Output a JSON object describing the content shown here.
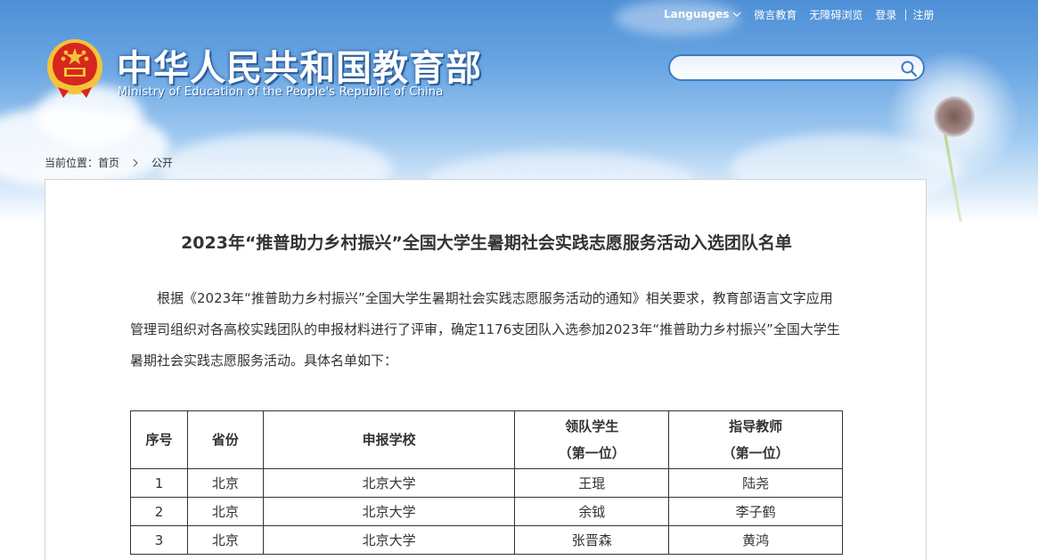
{
  "topbar": {
    "languages": "Languages",
    "weibo": "微言教育",
    "accessible": "无障碍浏览",
    "login": "登录",
    "separator": "|",
    "register": "注册"
  },
  "header": {
    "title_cn": "中华人民共和国教育部",
    "title_en": "Ministry of Education of the People's Republic of China"
  },
  "search": {
    "placeholder": ""
  },
  "breadcrumb": {
    "label": "当前位置：",
    "home": "首页",
    "current": "公开"
  },
  "article": {
    "title": "2023年“推普助力乡村振兴”全国大学生暑期社会实践志愿服务活动入选团队名单",
    "paragraph": "根据《2023年“推普助力乡村振兴”全国大学生暑期社会实践志愿服务活动的通知》相关要求，教育部语言文字应用管理司组织对各高校实践团队的申报材料进行了评审，确定1176支团队入选参加2023年“推普助力乡村振兴”全国大学生暑期社会实践志愿服务活动。具体名单如下："
  },
  "table": {
    "headers": {
      "no": "序号",
      "province": "省份",
      "school": "申报学校",
      "leader": "领队学生",
      "leader_sub": "（第一位）",
      "teacher": "指导教师",
      "teacher_sub": "（第一位）"
    },
    "rows": [
      {
        "no": "1",
        "province": "北京",
        "school": "北京大学",
        "leader": "王琨",
        "teacher": "陆尧"
      },
      {
        "no": "2",
        "province": "北京",
        "school": "北京大学",
        "leader": "余钺",
        "teacher": "李子鹤"
      },
      {
        "no": "3",
        "province": "北京",
        "school": "北京大学",
        "leader": "张晋森",
        "teacher": "黄鸿"
      }
    ]
  },
  "colors": {
    "sky_top": "#4d8fd6",
    "accent_blue": "#3e7cc4",
    "emblem_red": "#d7261e",
    "emblem_gold": "#f4c33b"
  }
}
